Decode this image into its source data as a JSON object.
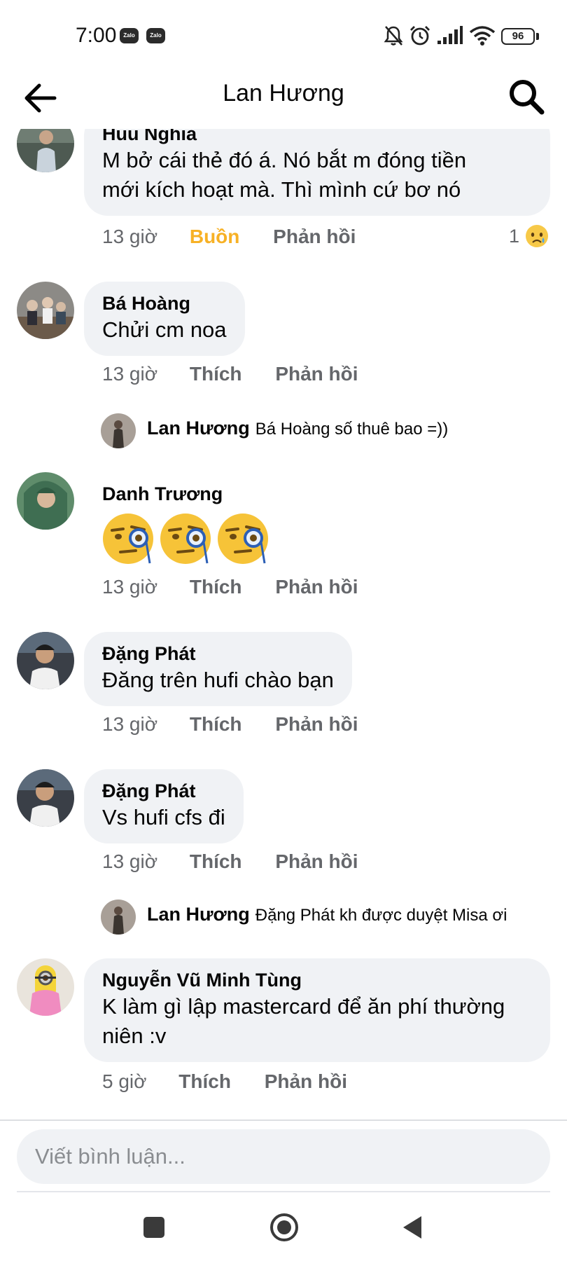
{
  "status_bar": {
    "time": "7:00",
    "notification_icons": [
      "Zalo",
      "Zalo"
    ],
    "battery": "96"
  },
  "header": {
    "title": "Lan Hương",
    "back_icon": "arrow-left-icon",
    "search_icon": "search-icon"
  },
  "comments": [
    {
      "name": "Huu Nghia",
      "text_lines": [
        "M bở cái thẻ đó á.  Nó bắt m đóng tiền",
        "mới kích hoạt mà.  Thì mình cứ bơ nó"
      ],
      "time": "13 giờ",
      "reaction_label": "Buồn",
      "reply_label": "Phản hồi",
      "reaction_count": "1",
      "reaction_icon": "sad-emoji-icon"
    },
    {
      "name": "Bá Hoàng",
      "text": "Chửi cm noa",
      "time": "13 giờ",
      "like_label": "Thích",
      "reply_label": "Phản hồi",
      "reply": {
        "name": "Lan Hương",
        "text": "Bá Hoàng số thuê bao =))"
      }
    },
    {
      "name": "Danh Trương",
      "emojis": [
        "monocle-face-emoji",
        "monocle-face-emoji",
        "monocle-face-emoji"
      ],
      "time": "13 giờ",
      "like_label": "Thích",
      "reply_label": "Phản hồi"
    },
    {
      "name": "Đặng Phát",
      "text": "Đăng trên hufi chào bạn",
      "time": "13 giờ",
      "like_label": "Thích",
      "reply_label": "Phản hồi"
    },
    {
      "name": "Đặng Phát",
      "text": "Vs hufi cfs đi",
      "time": "13 giờ",
      "like_label": "Thích",
      "reply_label": "Phản hồi",
      "reply": {
        "name": "Lan Hương",
        "text": "Đặng Phát kh được duyệt Misa ơi"
      }
    },
    {
      "name": "Nguyễn Vũ Minh Tùng",
      "text_lines": [
        "K làm gì lập mastercard để ăn phí thường",
        "niên :v"
      ],
      "time": "5 giờ",
      "like_label": "Thích",
      "reply_label": "Phản hồi"
    }
  ],
  "composer": {
    "placeholder": "Viết bình luận..."
  },
  "nav_bar": {
    "buttons": [
      "recents-square-icon",
      "home-circle-icon",
      "back-triangle-icon"
    ]
  }
}
